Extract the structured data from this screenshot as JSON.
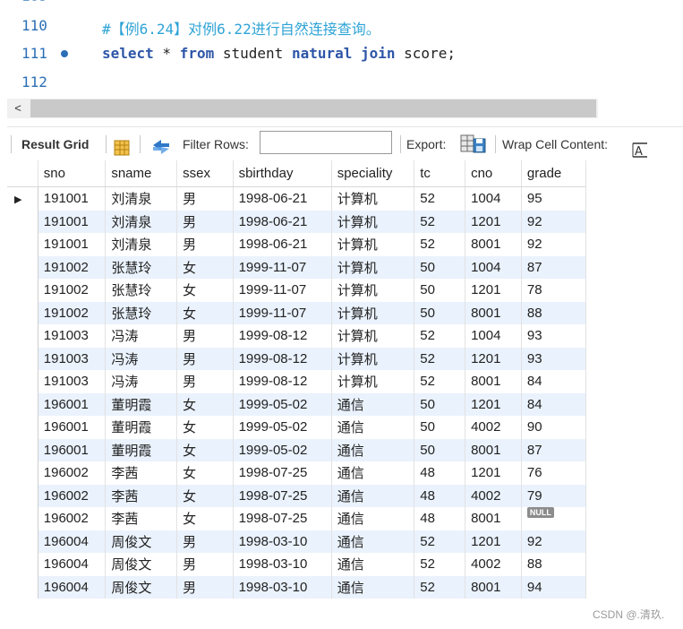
{
  "editor": {
    "lines": [
      {
        "no": "110",
        "parts": [
          {
            "cls": "cmt",
            "text": "#【例6.24】对例6.22进行自然连接查询。"
          }
        ]
      },
      {
        "no": "111",
        "parts": [
          {
            "cls": "kw",
            "text": "select"
          },
          {
            "cls": "txt",
            "text": " * "
          },
          {
            "cls": "kw",
            "text": "from"
          },
          {
            "cls": "txt",
            "text": " student "
          },
          {
            "cls": "kw",
            "text": "natural join"
          },
          {
            "cls": "txt",
            "text": " score;"
          }
        ]
      },
      {
        "no": "112",
        "parts": []
      }
    ]
  },
  "scrollbar": {
    "left_arrow": "<"
  },
  "toolbar": {
    "result_grid_label": "Result Grid",
    "filter_rows_label": "Filter Rows:",
    "filter_rows_value": "",
    "export_label": "Export:",
    "wrap_label": "Wrap Cell Content:"
  },
  "grid": {
    "columns": [
      "sno",
      "sname",
      "ssex",
      "sbirthday",
      "speciality",
      "tc",
      "cno",
      "grade"
    ],
    "rows": [
      [
        "191001",
        "刘清泉",
        "男",
        "1998-06-21",
        "计算机",
        "52",
        "1004",
        "95"
      ],
      [
        "191001",
        "刘清泉",
        "男",
        "1998-06-21",
        "计算机",
        "52",
        "1201",
        "92"
      ],
      [
        "191001",
        "刘清泉",
        "男",
        "1998-06-21",
        "计算机",
        "52",
        "8001",
        "92"
      ],
      [
        "191002",
        "张慧玲",
        "女",
        "1999-11-07",
        "计算机",
        "50",
        "1004",
        "87"
      ],
      [
        "191002",
        "张慧玲",
        "女",
        "1999-11-07",
        "计算机",
        "50",
        "1201",
        "78"
      ],
      [
        "191002",
        "张慧玲",
        "女",
        "1999-11-07",
        "计算机",
        "50",
        "8001",
        "88"
      ],
      [
        "191003",
        "冯涛",
        "男",
        "1999-08-12",
        "计算机",
        "52",
        "1004",
        "93"
      ],
      [
        "191003",
        "冯涛",
        "男",
        "1999-08-12",
        "计算机",
        "52",
        "1201",
        "93"
      ],
      [
        "191003",
        "冯涛",
        "男",
        "1999-08-12",
        "计算机",
        "52",
        "8001",
        "84"
      ],
      [
        "196001",
        "董明霞",
        "女",
        "1999-05-02",
        "通信",
        "50",
        "1201",
        "84"
      ],
      [
        "196001",
        "董明霞",
        "女",
        "1999-05-02",
        "通信",
        "50",
        "4002",
        "90"
      ],
      [
        "196001",
        "董明霞",
        "女",
        "1999-05-02",
        "通信",
        "50",
        "8001",
        "87"
      ],
      [
        "196002",
        "李茜",
        "女",
        "1998-07-25",
        "通信",
        "48",
        "1201",
        "76"
      ],
      [
        "196002",
        "李茜",
        "女",
        "1998-07-25",
        "通信",
        "48",
        "4002",
        "79"
      ],
      [
        "196002",
        "李茜",
        "女",
        "1998-07-25",
        "通信",
        "48",
        "8001",
        "NULL"
      ],
      [
        "196004",
        "周俊文",
        "男",
        "1998-03-10",
        "通信",
        "52",
        "1201",
        "92"
      ],
      [
        "196004",
        "周俊文",
        "男",
        "1998-03-10",
        "通信",
        "52",
        "4002",
        "88"
      ],
      [
        "196004",
        "周俊文",
        "男",
        "1998-03-10",
        "通信",
        "52",
        "8001",
        "94"
      ]
    ],
    "selected_row_marker": "▶"
  },
  "watermark": "CSDN @.清玖.",
  "icons": [
    "grid-view-icon",
    "refresh-icon",
    "export-icon",
    "wrap-text-icon"
  ],
  "colors": {
    "comment": "#2ea3d6",
    "keyword": "#2e56a8",
    "lineno": "#2b6fb6",
    "even_row": "#eaf2fd"
  }
}
